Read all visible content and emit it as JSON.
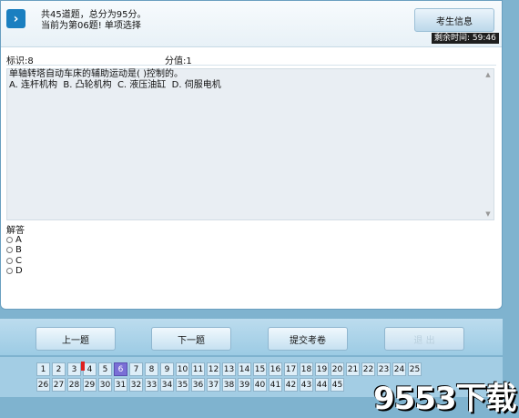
{
  "header": {
    "total_line": "共45道题，总分为95分。",
    "current_line": "当前为第06题! 单项选择",
    "info_button": "考生信息",
    "timer": "剩余时间: 59:46"
  },
  "question": {
    "id_label": "标识:8",
    "score_label": "分值:1",
    "text": "单轴转塔自动车床的辅助运动是( )控制的。",
    "options_line": "A. 连杆机构  B. 凸轮机构  C. 液压油缸  D. 伺服电机"
  },
  "answer": {
    "label": "解答",
    "options": [
      "A",
      "B",
      "C",
      "D"
    ]
  },
  "toolbar": {
    "prev": "上一题",
    "next": "下一题",
    "submit": "提交考卷",
    "exit": "退  出"
  },
  "pager": {
    "row1": [
      "1",
      "2",
      "3",
      "4",
      "5",
      "6",
      "7",
      "8",
      "9",
      "10",
      "11",
      "12",
      "13",
      "14",
      "15",
      "16",
      "17",
      "18",
      "19",
      "20",
      "21",
      "22",
      "23",
      "24",
      "25"
    ],
    "row2": [
      "26",
      "27",
      "28",
      "29",
      "30",
      "31",
      "32",
      "33",
      "34",
      "35",
      "36",
      "37",
      "38",
      "39",
      "40",
      "41",
      "42",
      "43",
      "44",
      "45"
    ],
    "current": "6",
    "flagged": "4"
  },
  "watermark": "9553下载"
}
